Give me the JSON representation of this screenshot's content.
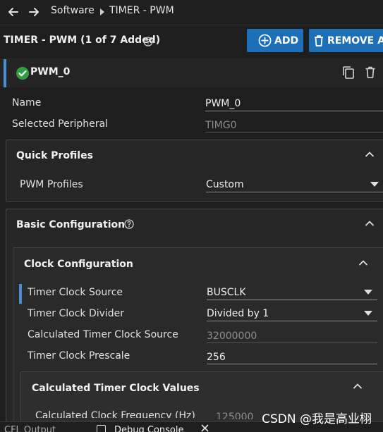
{
  "nav": {
    "breadcrumb_root": "Software",
    "breadcrumb_current": "TIMER - PWM"
  },
  "header": {
    "title": "TIMER - PWM (1 of 7 Added)",
    "add_label": "ADD",
    "remove_label": "REMOVE AL"
  },
  "instance": {
    "name": "PWM_0",
    "status_color": "#2ea043"
  },
  "fields": {
    "name_label": "Name",
    "name_value": "PWM_0",
    "peripheral_label": "Selected Peripheral",
    "peripheral_value": "TIMG0"
  },
  "quick_profiles": {
    "title": "Quick Profiles",
    "profiles_label": "PWM Profiles",
    "profiles_value": "Custom"
  },
  "basic_config": {
    "title": "Basic Configuration"
  },
  "clock_config": {
    "title": "Clock Configuration",
    "source_label": "Timer Clock Source",
    "source_value": "BUSCLK",
    "divider_label": "Timer Clock Divider",
    "divider_value": "Divided by 1",
    "calc_source_label": "Calculated Timer Clock Source",
    "calc_source_value": "32000000",
    "prescale_label": "Timer Clock Prescale",
    "prescale_value": "256"
  },
  "calc_values": {
    "title": "Calculated Timer Clock Values",
    "freq_label": "Calculated Clock Frequency (Hz)",
    "freq_value": "125000"
  },
  "bottom": {
    "tab1": "CFL Output",
    "tab2": "Debug Console"
  },
  "watermark": "CSDN @我是高业栩",
  "colors": {
    "accent": "#4a8fd6",
    "button": "#1d6fb8",
    "success": "#2ea043"
  }
}
